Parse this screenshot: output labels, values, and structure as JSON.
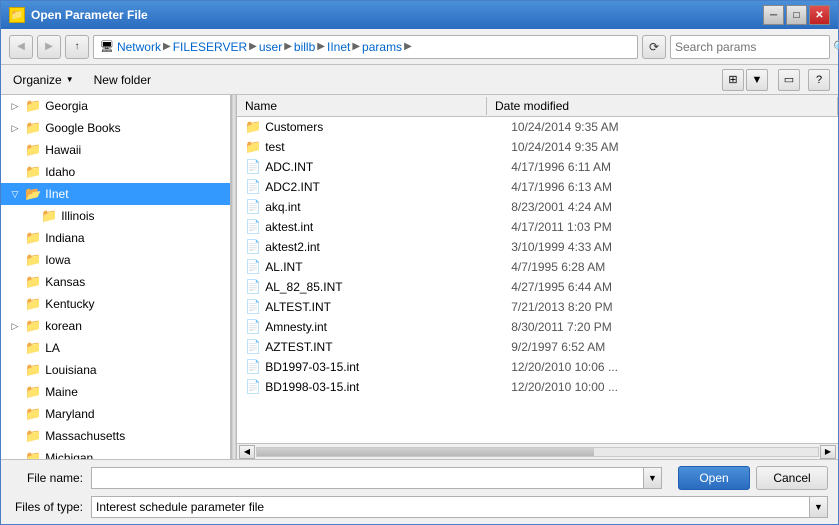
{
  "window": {
    "title": "Open Parameter File",
    "title_icon": "📁"
  },
  "toolbar": {
    "back_label": "◀",
    "forward_label": "▶",
    "up_label": "▲",
    "refresh_label": "⟳",
    "search_placeholder": "Search params",
    "breadcrumb": [
      {
        "label": "Network",
        "icon": "🖥"
      },
      {
        "label": "FILESERVER"
      },
      {
        "label": "user"
      },
      {
        "label": "billb"
      },
      {
        "label": "IInet"
      },
      {
        "label": "params"
      }
    ]
  },
  "actions": {
    "organize_label": "Organize",
    "new_folder_label": "New folder",
    "views_icon": "⊞",
    "help_icon": "?"
  },
  "left_panel": {
    "items": [
      {
        "id": "georgia",
        "label": "Georgia",
        "level": 1,
        "expanded": false,
        "selected": false
      },
      {
        "id": "google-books",
        "label": "Google Books",
        "level": 1,
        "expanded": false,
        "selected": false
      },
      {
        "id": "hawaii",
        "label": "Hawaii",
        "level": 1,
        "expanded": false,
        "selected": false
      },
      {
        "id": "idaho",
        "label": "Idaho",
        "level": 1,
        "expanded": false,
        "selected": false
      },
      {
        "id": "iinet",
        "label": "IInet",
        "level": 1,
        "expanded": true,
        "selected": true
      },
      {
        "id": "illinois",
        "label": "Illinois",
        "level": 1,
        "expanded": false,
        "selected": false
      },
      {
        "id": "indiana",
        "label": "Indiana",
        "level": 1,
        "expanded": false,
        "selected": false
      },
      {
        "id": "iowa",
        "label": "Iowa",
        "level": 1,
        "expanded": false,
        "selected": false
      },
      {
        "id": "kansas",
        "label": "Kansas",
        "level": 1,
        "expanded": false,
        "selected": false
      },
      {
        "id": "kentucky",
        "label": "Kentucky",
        "level": 1,
        "expanded": false,
        "selected": false
      },
      {
        "id": "korean",
        "label": "korean",
        "level": 1,
        "expanded": false,
        "selected": false
      },
      {
        "id": "la",
        "label": "LA",
        "level": 1,
        "expanded": false,
        "selected": false
      },
      {
        "id": "louisiana",
        "label": "Louisiana",
        "level": 1,
        "expanded": false,
        "selected": false
      },
      {
        "id": "maine",
        "label": "Maine",
        "level": 1,
        "expanded": false,
        "selected": false
      },
      {
        "id": "maryland",
        "label": "Maryland",
        "level": 1,
        "expanded": false,
        "selected": false
      },
      {
        "id": "massachusetts",
        "label": "Massachusetts",
        "level": 1,
        "expanded": false,
        "selected": false
      },
      {
        "id": "michigan",
        "label": "Michigan",
        "level": 1,
        "expanded": false,
        "selected": false
      }
    ]
  },
  "right_panel": {
    "col_name": "Name",
    "col_date": "Date modified",
    "files": [
      {
        "name": "Customers",
        "date": "10/24/2014 9:35 AM",
        "type": "folder"
      },
      {
        "name": "test",
        "date": "10/24/2014 9:35 AM",
        "type": "folder"
      },
      {
        "name": "ADC.INT",
        "date": "4/17/1996 6:11 AM",
        "type": "file"
      },
      {
        "name": "ADC2.INT",
        "date": "4/17/1996 6:13 AM",
        "type": "file"
      },
      {
        "name": "akq.int",
        "date": "8/23/2001 4:24 AM",
        "type": "file"
      },
      {
        "name": "aktest.int",
        "date": "4/17/2011 1:03 PM",
        "type": "file"
      },
      {
        "name": "aktest2.int",
        "date": "3/10/1999 4:33 AM",
        "type": "file"
      },
      {
        "name": "AL.INT",
        "date": "4/7/1995 6:28 AM",
        "type": "file"
      },
      {
        "name": "AL_82_85.INT",
        "date": "4/27/1995 6:44 AM",
        "type": "file"
      },
      {
        "name": "ALTEST.INT",
        "date": "7/21/2013 8:20 PM",
        "type": "file"
      },
      {
        "name": "Amnesty.int",
        "date": "8/30/2011 7:20 PM",
        "type": "file"
      },
      {
        "name": "AZTEST.INT",
        "date": "9/2/1997 6:52 AM",
        "type": "file"
      },
      {
        "name": "BD1997-03-15.int",
        "date": "12/20/2010 10:06 ...",
        "type": "file"
      },
      {
        "name": "BD1998-03-15.int",
        "date": "12/20/2010 10:00 ...",
        "type": "file"
      }
    ]
  },
  "bottom": {
    "filename_label": "File name:",
    "filename_value": "",
    "filetype_label": "Files of type:",
    "filetype_value": "Interest schedule parameter file",
    "open_label": "Open",
    "cancel_label": "Cancel"
  }
}
